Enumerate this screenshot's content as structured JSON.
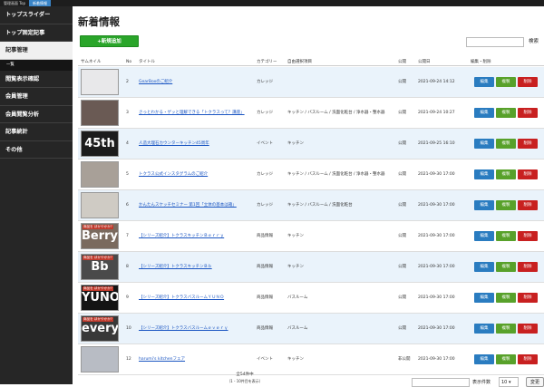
{
  "topbar": {
    "crumb1": "管理画面 Top",
    "crumb2": "新着情報"
  },
  "sidebar": {
    "items": [
      {
        "label": "トップスライダー"
      },
      {
        "label": "トップ固定記事"
      },
      {
        "label": "記事管理"
      },
      {
        "label": "閲覧表示確認"
      },
      {
        "label": "会員管理"
      },
      {
        "label": "会員閲覧分析"
      },
      {
        "label": "記事統計"
      },
      {
        "label": "その他"
      }
    ],
    "sub_label": "一覧"
  },
  "main": {
    "title": "新着情報",
    "add_button": "+新規追加",
    "search_button": "検索",
    "columns": {
      "thumb": "サムネイル",
      "no": "No",
      "title": "タイトル",
      "category": "カテゴリー",
      "free": "自由選択項目",
      "status": "公開",
      "date": "公開日",
      "actions": "編集・削除"
    },
    "buttons": {
      "edit": "編集",
      "copy": "複製",
      "delete": "削除"
    },
    "rows": [
      {
        "no": "2",
        "title": "GearBoxのご紹介",
        "category": "カレッジ",
        "free": "",
        "status": "公開",
        "date": "2021-09-24 14:12",
        "thumb_big": "",
        "thumb_cap": "",
        "thumb_color": "#e8e8ea"
      },
      {
        "no": "3",
        "title": "さっとわかる・ゲッと理解できる「トクラスって？講座」",
        "category": "カレッジ",
        "free": "キッチン / バスルーム / 洗面化粧台 / 浄水器・整水器",
        "status": "公開",
        "date": "2021-09-24 10:27",
        "thumb_big": "",
        "thumb_cap": "",
        "thumb_color": "#6a5a54"
      },
      {
        "no": "4",
        "title": "人造大理石カウンターキッチン45周年",
        "category": "イベント",
        "free": "キッチン",
        "status": "公開",
        "date": "2021-09-25 16:10",
        "thumb_big": "45th",
        "thumb_cap": "",
        "thumb_color": "#1c1c1c"
      },
      {
        "no": "5",
        "title": "トクラス公式インスタグラムのご紹介",
        "category": "カレッジ",
        "free": "キッチン / バスルーム / 洗面化粧台 / 浄水器・整水器",
        "status": "公開",
        "date": "2021-09-30 17:00",
        "thumb_big": "",
        "thumb_cap": "",
        "thumb_color": "#a8a098"
      },
      {
        "no": "6",
        "title": "かんたんスケッチセミナー 第1回「立体の基本は箱」",
        "category": "カレッジ",
        "free": "キッチン / バスルーム / 洗面化粧台",
        "status": "公開",
        "date": "2021-09-30 17:00",
        "thumb_big": "",
        "thumb_cap": "",
        "thumb_color": "#cfcbc4"
      },
      {
        "no": "7",
        "title": "【シリーズ紹介】トクラスキッチンＢｅｒｒｙ",
        "category": "商品情報",
        "free": "キッチン",
        "status": "公開",
        "date": "2021-09-30 17:00",
        "thumb_big": "Berry",
        "thumb_cap": "商品を ほかやかか?",
        "thumb_color": "#7a6a5e"
      },
      {
        "no": "8",
        "title": "【シリーズ紹介】トクラスキッチンＢｂ",
        "category": "商品情報",
        "free": "キッチン",
        "status": "公開",
        "date": "2021-09-30 17:00",
        "thumb_big": "Bb",
        "thumb_cap": "商品を ほかやかか?",
        "thumb_color": "#4a4a4a"
      },
      {
        "no": "9",
        "title": "【シリーズ紹介】トクラスバスルームＹＵＮＯ",
        "category": "商品情報",
        "free": "バスルーム",
        "status": "公開",
        "date": "2021-09-30 17:00",
        "thumb_big": "YUNO",
        "thumb_cap": "商品を ほかやかか?",
        "thumb_color": "#141414"
      },
      {
        "no": "10",
        "title": "【シリーズ紹介】トクラスバスルームｅｖｅｒｙ",
        "category": "商品情報",
        "free": "バスルーム",
        "status": "公開",
        "date": "2021-09-30 17:00",
        "thumb_big": "every",
        "thumb_cap": "商品を ほかやかか?",
        "thumb_color": "#383838"
      },
      {
        "no": "12",
        "title": "harumi's kitchenフェア",
        "category": "イベント",
        "free": "キッチン",
        "status": "非公開",
        "date": "2021-09-30 17:00",
        "thumb_big": "",
        "thumb_cap": "",
        "thumb_color": "#b8bcc4"
      }
    ]
  },
  "footer": {
    "count": "全54件中",
    "range": "（1 - 10件目を表示）",
    "perpage_label": "表示件数",
    "perpage_value": "10",
    "change_button": "変更"
  }
}
